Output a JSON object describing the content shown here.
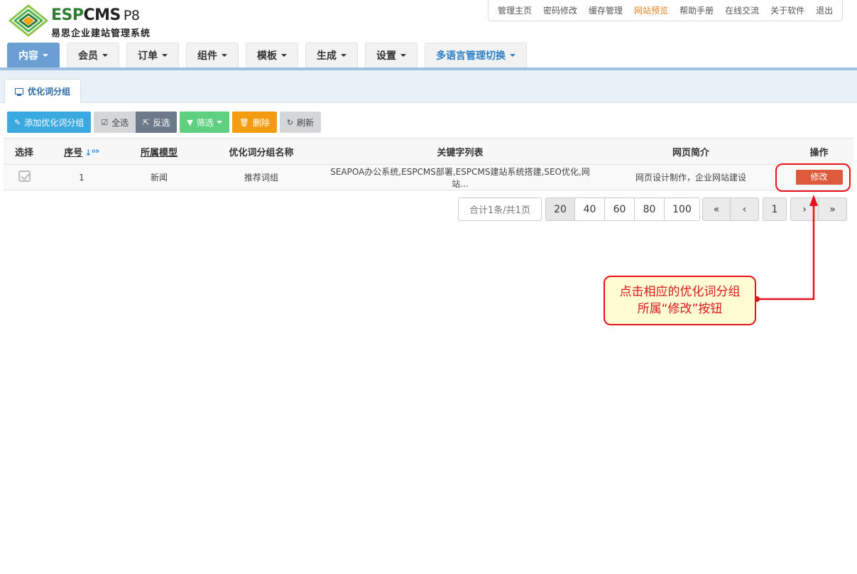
{
  "brand": {
    "name_part1": "ESP",
    "name_part2": "CMS",
    "version": "P8",
    "subtitle": "易思企业建站管理系统"
  },
  "toplinks": [
    {
      "label": "管理主页"
    },
    {
      "label": "密码修改"
    },
    {
      "label": "缓存管理"
    },
    {
      "label": "网站预览",
      "highlight": true
    },
    {
      "label": "帮助手册"
    },
    {
      "label": "在线交流"
    },
    {
      "label": "关于软件"
    },
    {
      "label": "退出"
    }
  ],
  "mainnav": {
    "tabs": [
      {
        "label": "内容",
        "active": true
      },
      {
        "label": "会员"
      },
      {
        "label": "订单"
      },
      {
        "label": "组件"
      },
      {
        "label": "模板"
      },
      {
        "label": "生成"
      },
      {
        "label": "设置"
      },
      {
        "label": "多语言管理切换"
      }
    ]
  },
  "subtab": {
    "label": "优化词分组",
    "icon": "monitor-icon"
  },
  "toolbar": {
    "add_label": "添加优化词分组",
    "select_all_label": "全选",
    "invert_label": "反选",
    "filter_label": "筛选",
    "delete_label": "删除",
    "refresh_label": "刷新"
  },
  "table": {
    "headers": {
      "select": "选择",
      "index": "序号",
      "model": "所属模型",
      "group_name": "优化词分组名称",
      "keywords": "关键字列表",
      "description": "网页简介",
      "action": "操作"
    },
    "rows": [
      {
        "index": "1",
        "model": "新闻",
        "group_name": "推荐词组",
        "keywords": "SEAPOA办公系统,ESPCMS部署,ESPCMS建站系统搭建,SEO优化,网站...",
        "description": "网页设计制作，企业网站建设",
        "action_label": "修改"
      }
    ]
  },
  "pagination": {
    "summary": "合计1条/共1页",
    "page_sizes": [
      "20",
      "40",
      "60",
      "80",
      "100"
    ],
    "selected_size": "20",
    "first_label": "«",
    "prev_label": "‹",
    "current_page": "1",
    "next_label": "›",
    "last_label": "»"
  },
  "annotation": {
    "line1": "点击相应的优化词分组",
    "line2": "所属“修改”按钮",
    "color": "#e8121b"
  },
  "colors": {
    "accent_blue": "#6b9fd4",
    "brand_green": "#2e7d32",
    "edit_button": "#dd5a3a"
  }
}
